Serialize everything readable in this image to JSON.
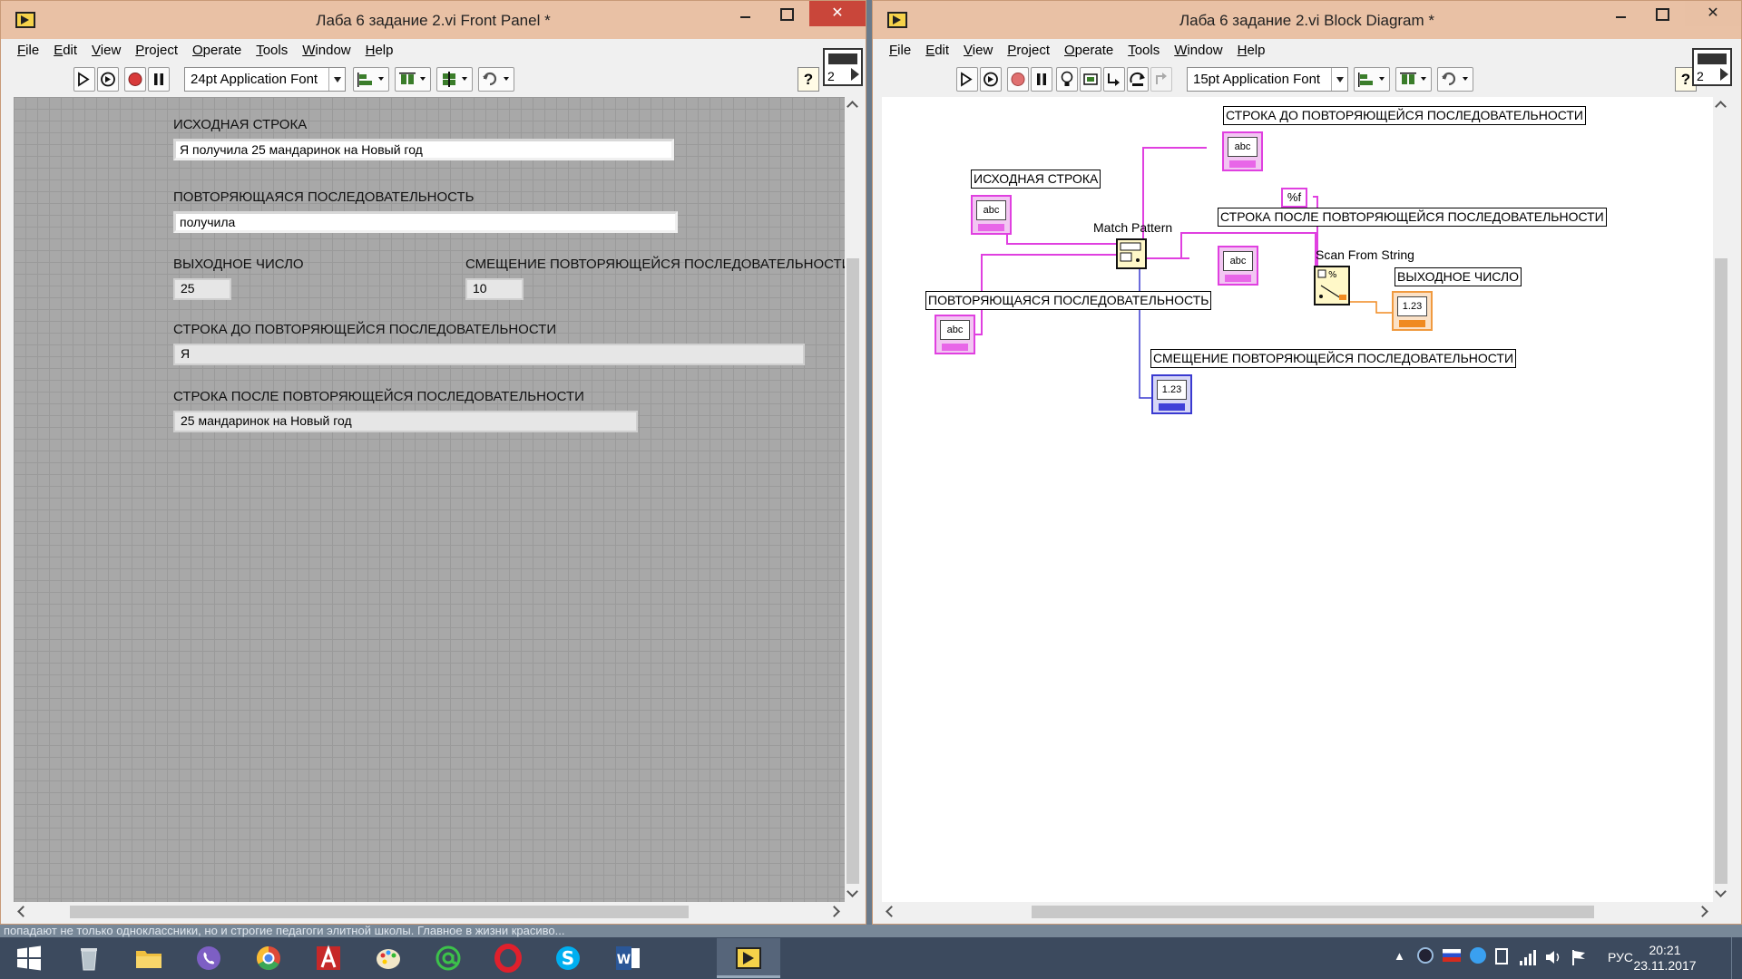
{
  "front_panel": {
    "title": "Лаба 6 задание 2.vi Front Panel *",
    "font": "24pt Application Font",
    "connector_number": "2",
    "menu": [
      "File",
      "Edit",
      "View",
      "Project",
      "Operate",
      "Tools",
      "Window",
      "Help"
    ],
    "controls": {
      "source_label": "ИСХОДНАЯ СТРОКА",
      "source_value": "Я получила 25 мандаринок на Новый год",
      "pattern_label": "ПОВТОРЯЮЩАЯСЯ ПОСЛЕДОВАТЕЛЬНОСТЬ",
      "pattern_value": "получила",
      "output_label": "ВЫХОДНОЕ ЧИСЛО",
      "output_value": "25",
      "offset_label": "СМЕЩЕНИЕ ПОВТОРЯЮЩЕЙСЯ ПОСЛЕДОВАТЕЛЬНОСТИ",
      "offset_value": "10",
      "before_label": "СТРОКА ДО ПОВТОРЯЮЩЕЙСЯ ПОСЛЕДОВАТЕЛЬНОСТИ",
      "before_value": "Я",
      "after_label": "СТРОКА ПОСЛЕ ПОВТОРЯЮЩЕЙСЯ ПОСЛЕДОВАТЕЛЬНОСТИ",
      "after_value": "25 мандаринок на Новый год"
    }
  },
  "block_diagram": {
    "title": "Лаба 6 задание 2.vi Block Diagram *",
    "font": "15pt Application Font",
    "connector_number": "2",
    "menu": [
      "File",
      "Edit",
      "View",
      "Project",
      "Operate",
      "Tools",
      "Window",
      "Help"
    ],
    "labels": {
      "before": "СТРОКА ДО ПОВТОРЯЮЩЕЙСЯ ПОСЛЕДОВАТЕЛЬНОСТИ",
      "source": "ИСХОДНАЯ СТРОКА",
      "after": "СТРОКА ПОСЛЕ ПОВТОРЯЮЩЕЙСЯ ПОСЛЕДОВАТЕЛЬНОСТИ",
      "pattern": "ПОВТОРЯЮЩАЯСЯ ПОСЛЕДОВАТЕЛЬНОСТЬ",
      "output": "ВЫХОДНОЕ ЧИСЛО",
      "offset": "СМЕЩЕНИЕ ПОВТОРЯЮЩЕЙСЯ ПОСЛЕДОВАТЕЛЬНОСТИ",
      "match_pattern": "Match Pattern",
      "scan_from_string": "Scan From String",
      "format_const": "%f",
      "terminal_string": "abc",
      "terminal_number": "1.23"
    }
  },
  "desktop_text": "попадают не только одноклассники, но и строгие педагоги элитной школы. Главное в жизни красиво...",
  "taskbar": {
    "apps": [
      "windows-start",
      "recycle-bin",
      "file-explorer",
      "viber",
      "chrome",
      "autocad",
      "paint",
      "mail-agent",
      "opera",
      "skype",
      "word",
      "labview"
    ],
    "language": "РУС",
    "time": "20:21",
    "date": "23.11.2017"
  },
  "colors": {
    "string_wire": "#e040e0",
    "numeric_wire": "#3a3ad0",
    "double_wire": "#f08a20",
    "title_bar": "#e9c1a5",
    "close_button": "#c9463a"
  }
}
